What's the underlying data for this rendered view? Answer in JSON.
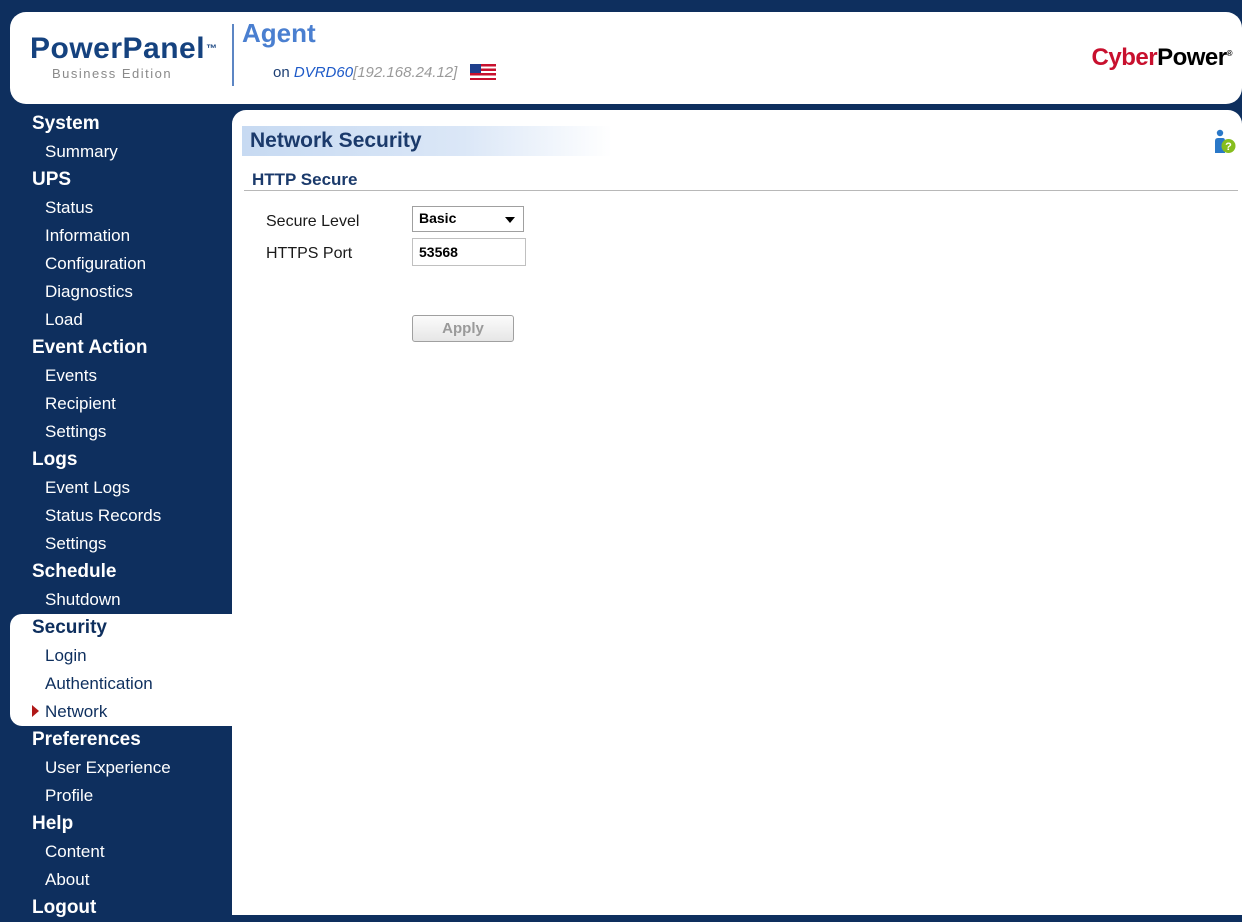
{
  "header": {
    "brand_name": "PowerPanel",
    "brand_tm": "™",
    "brand_edition": "Business Edition",
    "agent_title": "Agent",
    "on_label": "on",
    "host": "DVRD60",
    "ip_open": "[",
    "ip": "192.168.24.12",
    "ip_close": "]",
    "vendor_a": "Cyber",
    "vendor_b": "Power",
    "vendor_mark": "®"
  },
  "sidebar": {
    "sections": [
      {
        "title": "System",
        "items": [
          "Summary"
        ]
      },
      {
        "title": "UPS",
        "items": [
          "Status",
          "Information",
          "Configuration",
          "Diagnostics",
          "Load"
        ]
      },
      {
        "title": "Event Action",
        "items": [
          "Events",
          "Recipient",
          "Settings"
        ]
      },
      {
        "title": "Logs",
        "items": [
          "Event Logs",
          "Status Records",
          "Settings"
        ]
      },
      {
        "title": "Schedule",
        "items": [
          "Shutdown"
        ]
      },
      {
        "title": "Security",
        "items": [
          "Login",
          "Authentication",
          "Network"
        ]
      },
      {
        "title": "Preferences",
        "items": [
          "User Experience",
          "Profile"
        ]
      },
      {
        "title": "Help",
        "items": [
          "Content",
          "About"
        ]
      },
      {
        "title": "Logout",
        "items": []
      }
    ]
  },
  "main": {
    "page_title": "Network Security",
    "section_title": "HTTP Secure",
    "secure_level_label": "Secure Level",
    "secure_level_value": "Basic",
    "https_port_label": "HTTPS Port",
    "https_port_value": "53568",
    "apply_label": "Apply"
  },
  "colors": {
    "navy": "#0e2f5e",
    "accent_blue": "#4a7fd0",
    "brand_red": "#c8102e",
    "active_arrow": "#b01818"
  },
  "icons": [
    "flag-icon",
    "help-info-icon",
    "arrow-right-icon",
    "chevron-down-icon"
  ]
}
